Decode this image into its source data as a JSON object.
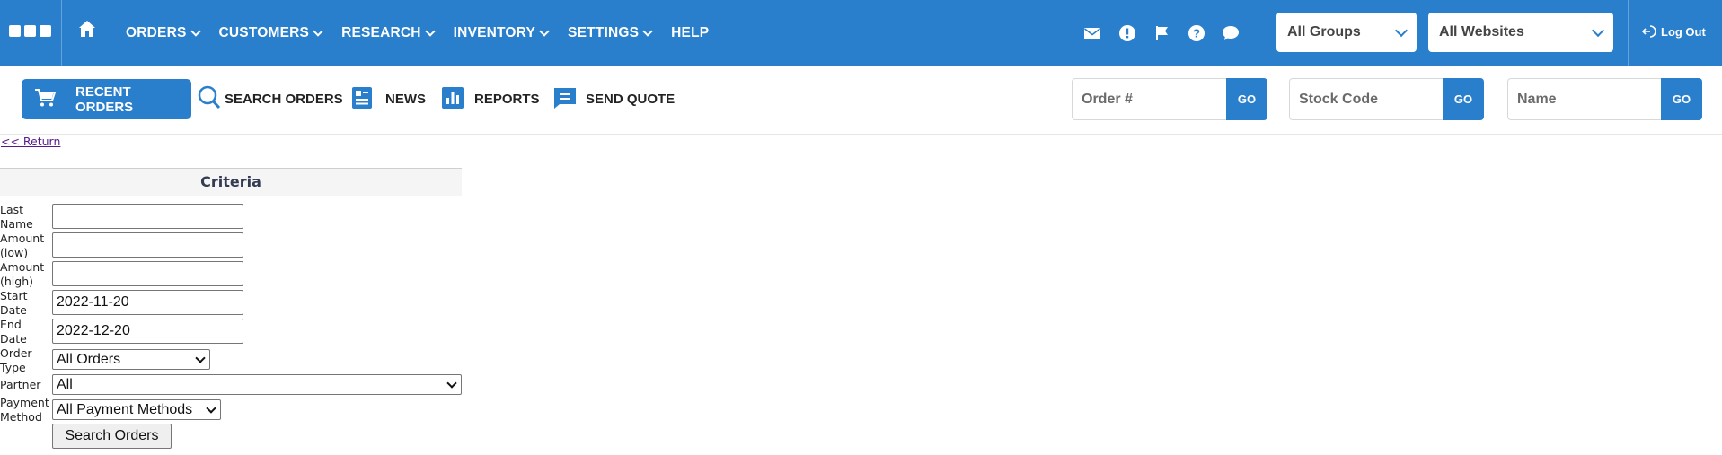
{
  "nav": {
    "items": [
      {
        "label": "ORDERS",
        "has_dropdown": true
      },
      {
        "label": "CUSTOMERS",
        "has_dropdown": true
      },
      {
        "label": "RESEARCH",
        "has_dropdown": true
      },
      {
        "label": "INVENTORY",
        "has_dropdown": true
      },
      {
        "label": "SETTINGS",
        "has_dropdown": true
      },
      {
        "label": "HELP",
        "has_dropdown": false
      }
    ],
    "icons": [
      "mail-icon",
      "alert-icon",
      "flag-icon",
      "help-icon",
      "chat-icon"
    ],
    "group_select": "All Groups",
    "website_select": "All Websites",
    "logout_label": "Log Out"
  },
  "toolbar": {
    "recent_orders": "RECENT ORDERS",
    "search_orders": "SEARCH ORDERS",
    "news": "NEWS",
    "reports": "REPORTS",
    "send_quote": "SEND QUOTE",
    "quick_search": [
      {
        "placeholder": "Order #",
        "go": "GO"
      },
      {
        "placeholder": "Stock Code",
        "go": "GO"
      },
      {
        "placeholder": "Name",
        "go": "GO"
      }
    ]
  },
  "page": {
    "return_link": "<< Return",
    "criteria_title": "Criteria",
    "fields": {
      "last_name": {
        "label": "Last Name",
        "value": ""
      },
      "amount_low": {
        "label": "Amount (low)",
        "value": ""
      },
      "amount_high": {
        "label": "Amount (high)",
        "value": ""
      },
      "start_date": {
        "label": "Start Date",
        "value": "2022-11-20"
      },
      "end_date": {
        "label": "End Date",
        "value": "2022-12-20"
      },
      "order_type": {
        "label": "Order Type",
        "value": "All Orders"
      },
      "partner": {
        "label": "Partner",
        "value": "All"
      },
      "payment_method": {
        "label": "Payment Method",
        "value": "All Payment Methods"
      }
    },
    "submit_label": "Search Orders"
  },
  "colors": {
    "brand": "#2a7fcc",
    "link_visited": "#551a8b",
    "criteria_title": "#333c52"
  }
}
